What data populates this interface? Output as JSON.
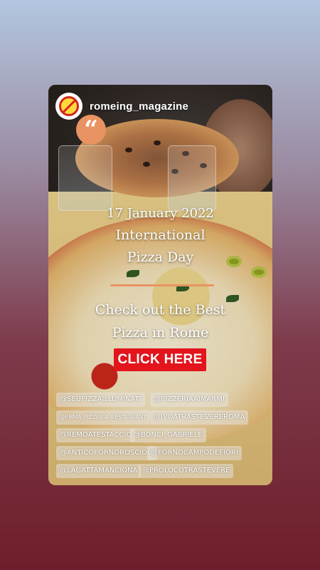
{
  "account": {
    "username": "romeing_magazine",
    "avatar_icon": "lightning-no-sign-icon"
  },
  "story": {
    "quote_glyph": "“",
    "date": "17 January 2022",
    "title_line1": "International",
    "title_line2": "Pizza Day",
    "subtitle_line1": "Check out the Best",
    "subtitle_line2": "Pizza in Rome",
    "cta_label": "CLICK HERE",
    "accent_color": "#e99362",
    "cta_color": "#e3141b"
  },
  "mentions": [
    [
      "@SEUPIZZAILLUMINATI",
      "@PIZZERIAAIMARMI"
    ],
    [
      "@EMMA_PIZZERIA_RESTAURANT",
      "@IVOATRASTEVEREROMA"
    ],
    [
      "@REMOATESTACCIO",
      "@BONCI_GABRIELE"
    ],
    [
      "@ANTICOFORNOROSCIOLI",
      "@FORNOCAMPODEFIORI"
    ],
    [
      "@LAGATTAMANCIONA",
      "@PROLOCOTRASTEVERE"
    ]
  ]
}
